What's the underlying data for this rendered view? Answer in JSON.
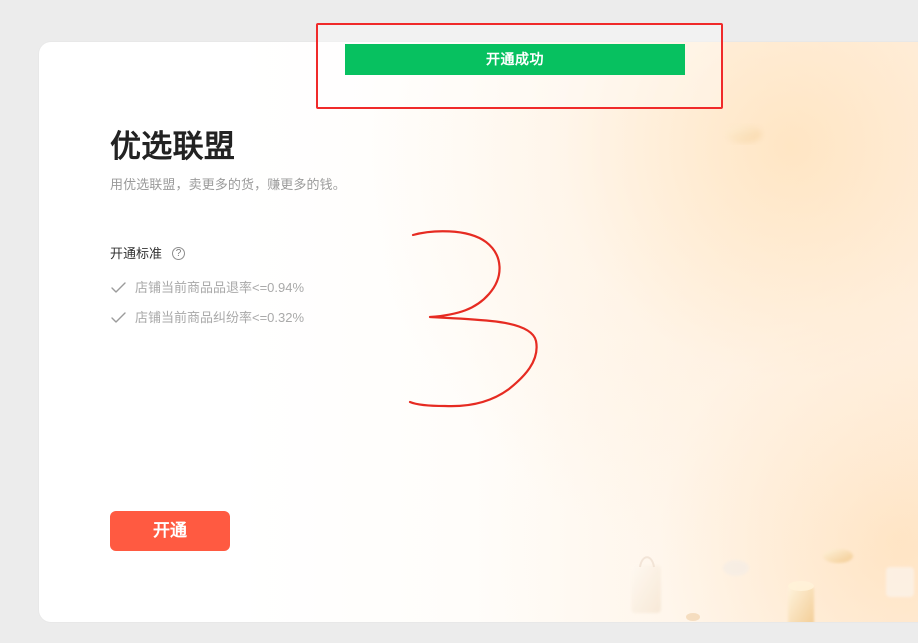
{
  "toast": {
    "message": "开通成功"
  },
  "header": {
    "title": "优选联盟",
    "subtitle": "用优选联盟，卖更多的货，赚更多的钱。"
  },
  "criteria": {
    "label": "开通标准",
    "help_icon": "question-circle-icon",
    "items": [
      {
        "icon": "check-icon",
        "text": "店铺当前商品品退率<=0.94%"
      },
      {
        "icon": "check-icon",
        "text": "店铺当前商品纠纷率<=0.32%"
      }
    ]
  },
  "actions": {
    "open_label": "开通"
  },
  "colors": {
    "page_background": "#ececec",
    "card_background": "#ffffff",
    "success_green": "#07c160",
    "annotation_red": "#f02a2a",
    "button_orange": "#ff5a41"
  }
}
